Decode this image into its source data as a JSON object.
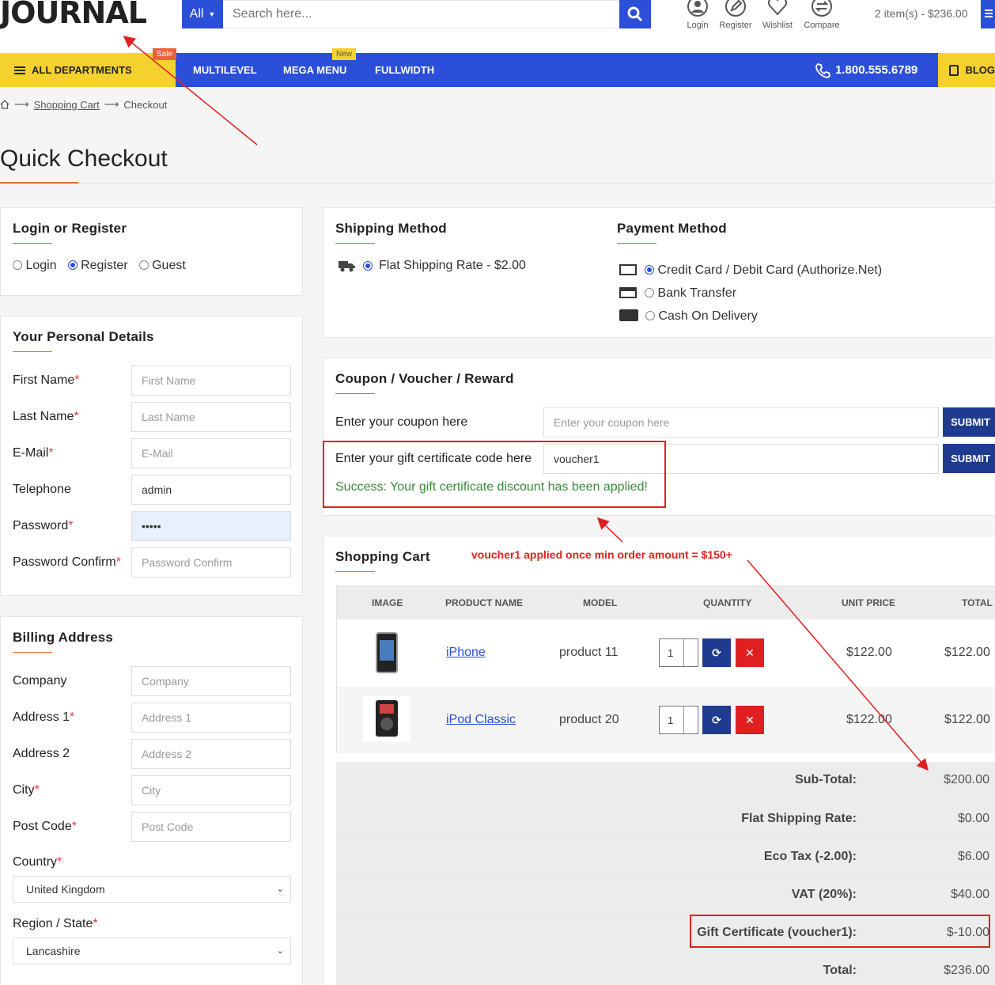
{
  "header": {
    "logo": "JOURNAL",
    "search_category": "All",
    "search_placeholder": "Search here...",
    "top_links": [
      "Login",
      "Register",
      "Wishlist",
      "Compare"
    ],
    "cart_summary": "2 item(s) - $236.00"
  },
  "nav": {
    "departments": "ALL DEPARTMENTS",
    "sale_badge": "Sale",
    "items": [
      "MULTILEVEL",
      "MEGA MENU",
      "FULLWIDTH"
    ],
    "new_badge": "New",
    "phone": "1.800.555.6789",
    "blog": "BLOG"
  },
  "breadcrumb": {
    "shopping_cart": "Shopping Cart",
    "checkout": "Checkout"
  },
  "page_title": "Quick Checkout",
  "login": {
    "title": "Login or Register",
    "options": [
      "Login",
      "Register",
      "Guest"
    ],
    "selected": "Register"
  },
  "personal": {
    "title": "Your Personal Details",
    "fields": [
      {
        "label": "First Name",
        "required": true,
        "placeholder": "First Name",
        "value": ""
      },
      {
        "label": "Last Name",
        "required": true,
        "placeholder": "Last Name",
        "value": ""
      },
      {
        "label": "E-Mail",
        "required": true,
        "placeholder": "E-Mail",
        "value": ""
      },
      {
        "label": "Telephone",
        "required": false,
        "placeholder": "",
        "value": "admin"
      },
      {
        "label": "Password",
        "required": true,
        "placeholder": "",
        "value": "•••••"
      },
      {
        "label": "Password Confirm",
        "required": true,
        "placeholder": "Password Confirm",
        "value": ""
      }
    ]
  },
  "billing": {
    "title": "Billing Address",
    "fields": [
      {
        "label": "Company",
        "required": false,
        "placeholder": "Company"
      },
      {
        "label": "Address 1",
        "required": true,
        "placeholder": "Address 1"
      },
      {
        "label": "Address 2",
        "required": false,
        "placeholder": "Address 2"
      },
      {
        "label": "City",
        "required": true,
        "placeholder": "City"
      },
      {
        "label": "Post Code",
        "required": true,
        "placeholder": "Post Code"
      }
    ],
    "country_label": "Country",
    "country": "United Kingdom",
    "region_label": "Region / State",
    "region": "Lancashire"
  },
  "shipping": {
    "title": "Shipping Method",
    "option": "Flat Shipping Rate - $2.00"
  },
  "payment": {
    "title": "Payment Method",
    "options": [
      "Credit Card / Debit Card (Authorize.Net)",
      "Bank Transfer",
      "Cash On Delivery"
    ],
    "selected": "Credit Card / Debit Card (Authorize.Net)"
  },
  "coupon": {
    "title": "Coupon / Voucher / Reward",
    "coupon_label": "Enter your coupon here",
    "coupon_placeholder": "Enter your coupon here",
    "gift_label": "Enter your gift certificate code here",
    "gift_value": "voucher1",
    "submit": "SUBMIT",
    "success": "Success: Your gift certificate discount has been applied!"
  },
  "cart": {
    "title": "Shopping Cart",
    "annotation": "voucher1 applied once min order amount = $150+",
    "columns": [
      "IMAGE",
      "PRODUCT NAME",
      "MODEL",
      "QUANTITY",
      "UNIT PRICE",
      "TOTAL"
    ],
    "rows": [
      {
        "name": "iPhone",
        "model": "product 11",
        "qty": "1",
        "unit": "$122.00",
        "total": "$122.00"
      },
      {
        "name": "iPod Classic",
        "model": "product 20",
        "qty": "1",
        "unit": "$122.00",
        "total": "$122.00"
      }
    ],
    "totals": [
      {
        "label": "Sub-Total:",
        "value": "$200.00"
      },
      {
        "label": "Flat Shipping Rate:",
        "value": "$0.00"
      },
      {
        "label": "Eco Tax (-2.00):",
        "value": "$6.00"
      },
      {
        "label": "VAT (20%):",
        "value": "$40.00"
      },
      {
        "label": "Gift Certificate (voucher1):",
        "value": "$-10.00"
      },
      {
        "label": "Total:",
        "value": "$236.00"
      }
    ]
  },
  "colors": {
    "primary": "#2b4fd8",
    "accent": "#f5d12e",
    "navy": "#1f3b8f",
    "danger": "#e02020",
    "success": "#3a8a3a"
  }
}
